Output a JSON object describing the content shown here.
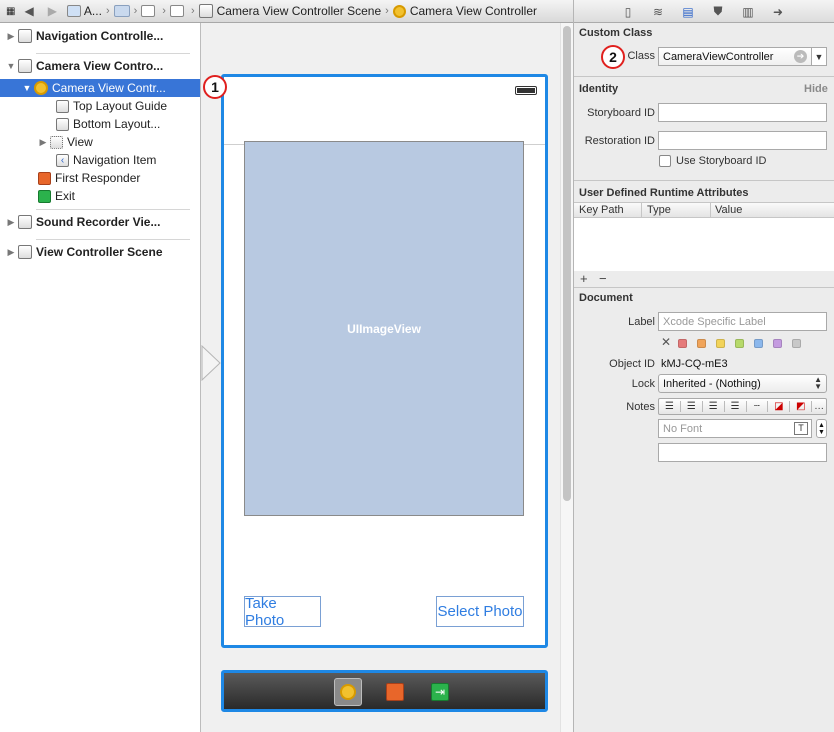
{
  "jumpbar": {
    "crumbs": [
      "A...",
      "Camera View Controller Scene",
      "Camera View Controller"
    ]
  },
  "navigator": {
    "items": [
      {
        "label": "Navigation Controlle...",
        "bold": true,
        "expanded": false
      },
      {
        "label": "Camera View Contro...",
        "bold": true,
        "expanded": true
      },
      {
        "label": "Camera View Contr...",
        "selected": true
      },
      {
        "label": "Top Layout Guide"
      },
      {
        "label": "Bottom Layout..."
      },
      {
        "label": "View"
      },
      {
        "label": "Navigation Item"
      },
      {
        "label": "First Responder"
      },
      {
        "label": "Exit"
      },
      {
        "label": "Sound Recorder Vie...",
        "bold": true
      },
      {
        "label": "View Controller Scene",
        "bold": true
      }
    ]
  },
  "canvas": {
    "image_view_label": "UIImageView",
    "take_photo_label": "Take Photo",
    "select_photo_label": "Select Photo",
    "badge1": "1"
  },
  "inspector": {
    "custom_class": {
      "header": "Custom Class",
      "badge": "2",
      "class_label": "Class",
      "class_value": "CameraViewController"
    },
    "identity": {
      "header": "Identity",
      "hide_label": "Hide",
      "storyboard_id_label": "Storyboard ID",
      "restoration_id_label": "Restoration ID",
      "use_storyboard_id_label": "Use Storyboard ID"
    },
    "runtime": {
      "header": "User Defined Runtime Attributes",
      "col_keypath": "Key Path",
      "col_type": "Type",
      "col_value": "Value",
      "add": "+",
      "remove": "−"
    },
    "document": {
      "header": "Document",
      "label_label": "Label",
      "label_placeholder": "Xcode Specific Label",
      "object_id_label": "Object ID",
      "object_id_value": "kMJ-CQ-mE3",
      "lock_label": "Lock",
      "lock_value": "Inherited - (Nothing)",
      "notes_label": "Notes",
      "font_placeholder": "No Font",
      "swatch_colors": [
        "#e57a7a",
        "#f0a45a",
        "#f2d35a",
        "#b6d96a",
        "#8bb7ec",
        "#c49be0",
        "#c8c8c8"
      ]
    }
  },
  "colors": {
    "selection": "#3875d7",
    "scene_border": "#1e88e5",
    "image_view_fill": "#b8c9e1",
    "button_text": "#2f7de1",
    "badge_ring": "#e0201e"
  }
}
